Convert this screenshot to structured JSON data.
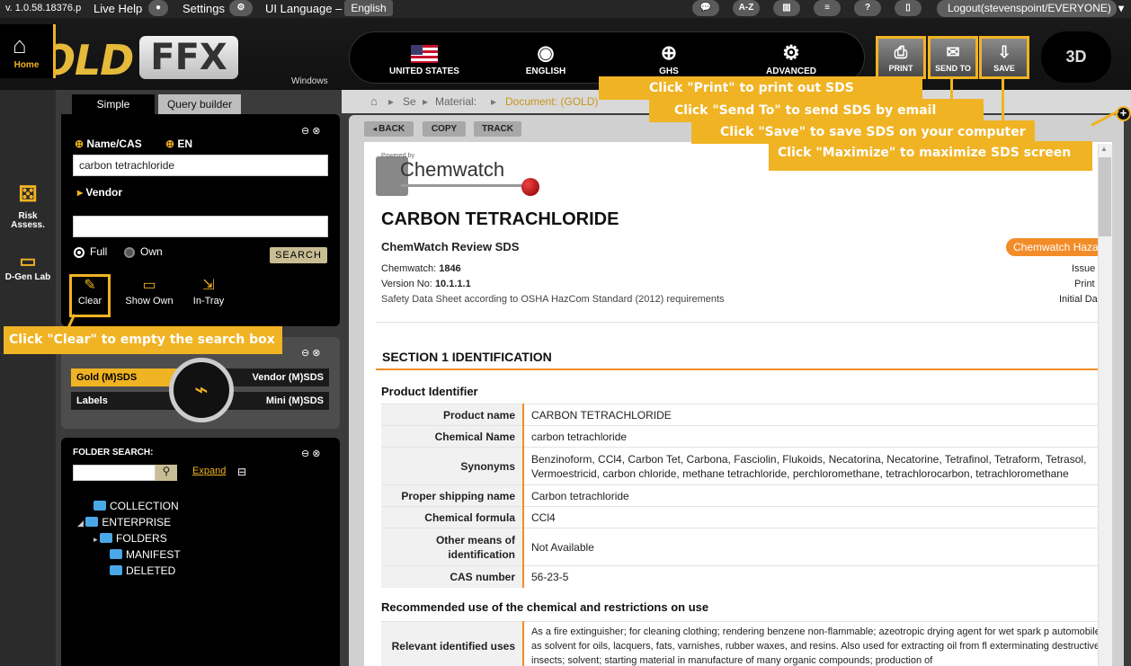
{
  "topbar": {
    "version": "v. 1.0.58.18376.p",
    "live_help": "Live Help",
    "settings": "Settings",
    "ui_language_label": "UI Language –",
    "ui_language_value": "English",
    "az": "A-Z",
    "help": "?",
    "logout": "Logout(stevenspoint/EVERYONE)"
  },
  "header": {
    "logo_left": "GOLD",
    "logo_right": "FFX",
    "windows": "Windows",
    "nav": [
      {
        "label": "UNITED STATES",
        "icon": "flag-icon"
      },
      {
        "label": "ENGLISH",
        "icon": "globe-chat-icon"
      },
      {
        "label": "GHS",
        "icon": "globe-icon"
      },
      {
        "label": "ADVANCED",
        "icon": "gear-icon"
      }
    ],
    "tools": [
      {
        "label": "PRINT",
        "icon": "printer-icon"
      },
      {
        "label": "SEND TO",
        "icon": "envelope-icon"
      },
      {
        "label": "SAVE",
        "icon": "download-icon"
      }
    ],
    "three_d": "3D"
  },
  "rail": [
    {
      "label": "Home",
      "icon": "home-icon"
    },
    {
      "label": "Risk Assess.",
      "icon": "dice-icon"
    },
    {
      "label": "D-Gen Lab",
      "icon": "lab-icon"
    }
  ],
  "search": {
    "tab_simple": "Simple",
    "tab_query": "Query builder",
    "name_cas": "Name/CAS",
    "lang": "EN",
    "query": "carbon tetrachloride",
    "vendor": "Vendor",
    "vendor_value": "",
    "full": "Full",
    "own": "Own",
    "search_btn": "SEARCH",
    "tools": [
      "Clear",
      "Show Own",
      "In-Tray"
    ]
  },
  "types": {
    "gold": "Gold (M)SDS",
    "vendor": "Vendor (M)SDS",
    "labels": "Labels",
    "mini": "Mini (M)SDS"
  },
  "folders": {
    "title": "FOLDER SEARCH:",
    "expand": "Expand",
    "nodes": [
      "COLLECTION",
      "ENTERPRISE",
      "FOLDERS",
      "MANIFEST",
      "DELETED"
    ]
  },
  "callouts": {
    "print": "Click \"Print\" to print out SDS",
    "send": "Click \"Send To\" to send SDS by email",
    "save": "Click \"Save\" to save SDS on your computer",
    "maximize": "Click \"Maximize\" to maximize SDS screen",
    "clear": "Click \"Clear\" to empty the search box"
  },
  "breadcrumb": {
    "sep_short": "Se",
    "material": "Material:",
    "document": "Document: (GOLD)"
  },
  "content_buttons": [
    "BACK",
    "COPY",
    "TRACK"
  ],
  "doc": {
    "brand_small": "Powered by",
    "brand": "Chemwatch",
    "title": "CARBON TETRACHLORIDE",
    "subtitle": "ChemWatch Review SDS",
    "hazard_badge": "Chemwatch Haza",
    "chemwatch_label": "Chemwatch:",
    "chemwatch_no": "1846",
    "version_label": "Version No:",
    "version_no": "10.1.1.1",
    "osha": "Safety Data Sheet according to OSHA HazCom Standard (2012) requirements",
    "right_issue": "Issue",
    "right_print": "Print",
    "right_initial": "Initial Da",
    "section1": "SECTION 1 IDENTIFICATION",
    "product_identifier": "Product Identifier",
    "rows": [
      {
        "k": "Product name",
        "v": "CARBON TETRACHLORIDE"
      },
      {
        "k": "Chemical Name",
        "v": "carbon tetrachloride"
      },
      {
        "k": "Synonyms",
        "v": "Benzinoform, CCl4, Carbon Tet, Carbona, Fasciolin, Flukoids, Necatorina, Necatorine, Tetrafinol, Tetraform, Tetrasol, Vermoestricid, carbon chloride, methane tetrachloride, perchloromethane, tetrachlorocarbon, tetrachloromethane"
      },
      {
        "k": "Proper shipping name",
        "v": "Carbon tetrachloride"
      },
      {
        "k": "Chemical formula",
        "v": "CCl4"
      },
      {
        "k": "Other means of identification",
        "v": "Not Available"
      },
      {
        "k": "CAS number",
        "v": "56-23-5"
      }
    ],
    "recommended": "Recommended use of the chemical and restrictions on use",
    "uses_key": "Relevant identified uses",
    "uses_val": "As a fire extinguisher; for cleaning clothing; rendering benzene non-flammable; azeotropic drying agent for wet spark p automobiles; as solvent for oils, lacquers, fats, varnishes, rubber waxes, and resins. Also used for extracting oil from fl exterminating destructive insects; solvent; starting material in manufacture of many organic compounds; production of"
  }
}
